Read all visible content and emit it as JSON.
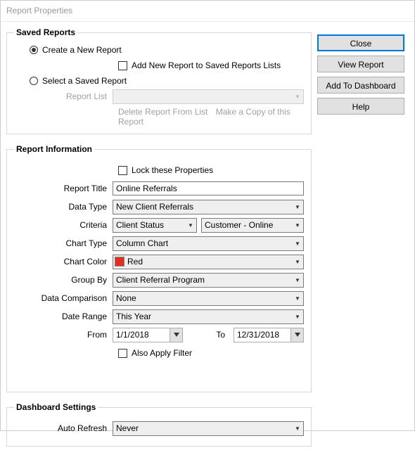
{
  "window": {
    "title": "Report Properties"
  },
  "buttons": {
    "close": "Close",
    "view_report": "View Report",
    "add_dashboard": "Add To Dashboard",
    "help": "Help"
  },
  "saved_reports": {
    "legend": "Saved Reports",
    "create_new": "Create a New Report",
    "add_new_to_lists": "Add New Report to Saved Reports Lists",
    "select_saved": "Select a Saved Report",
    "report_list_label": "Report List",
    "delete_link": "Delete Report From List",
    "copy_link": "Make a Copy of this Report"
  },
  "report_info": {
    "legend": "Report Information",
    "lock_label": "Lock these Properties",
    "title_label": "Report Title",
    "title_value": "Online Referrals",
    "data_type_label": "Data Type",
    "data_type_value": "New Client Referrals",
    "criteria_label": "Criteria",
    "criteria1_value": "Client Status",
    "criteria2_value": "Customer - Online",
    "chart_type_label": "Chart Type",
    "chart_type_value": "Column Chart",
    "chart_color_label": "Chart Color",
    "chart_color_value": "Red",
    "chart_color_hex": "#e03020",
    "group_by_label": "Group By",
    "group_by_value": "Client Referral Program",
    "comparison_label": "Data Comparison",
    "comparison_value": "None",
    "date_range_label": "Date Range",
    "date_range_value": "This Year",
    "from_label": "From",
    "from_value": "1/1/2018",
    "to_label": "To",
    "to_value": "12/31/2018",
    "also_filter_label": "Also Apply Filter"
  },
  "dashboard": {
    "legend": "Dashboard Settings",
    "auto_refresh_label": "Auto Refresh",
    "auto_refresh_value": "Never"
  }
}
